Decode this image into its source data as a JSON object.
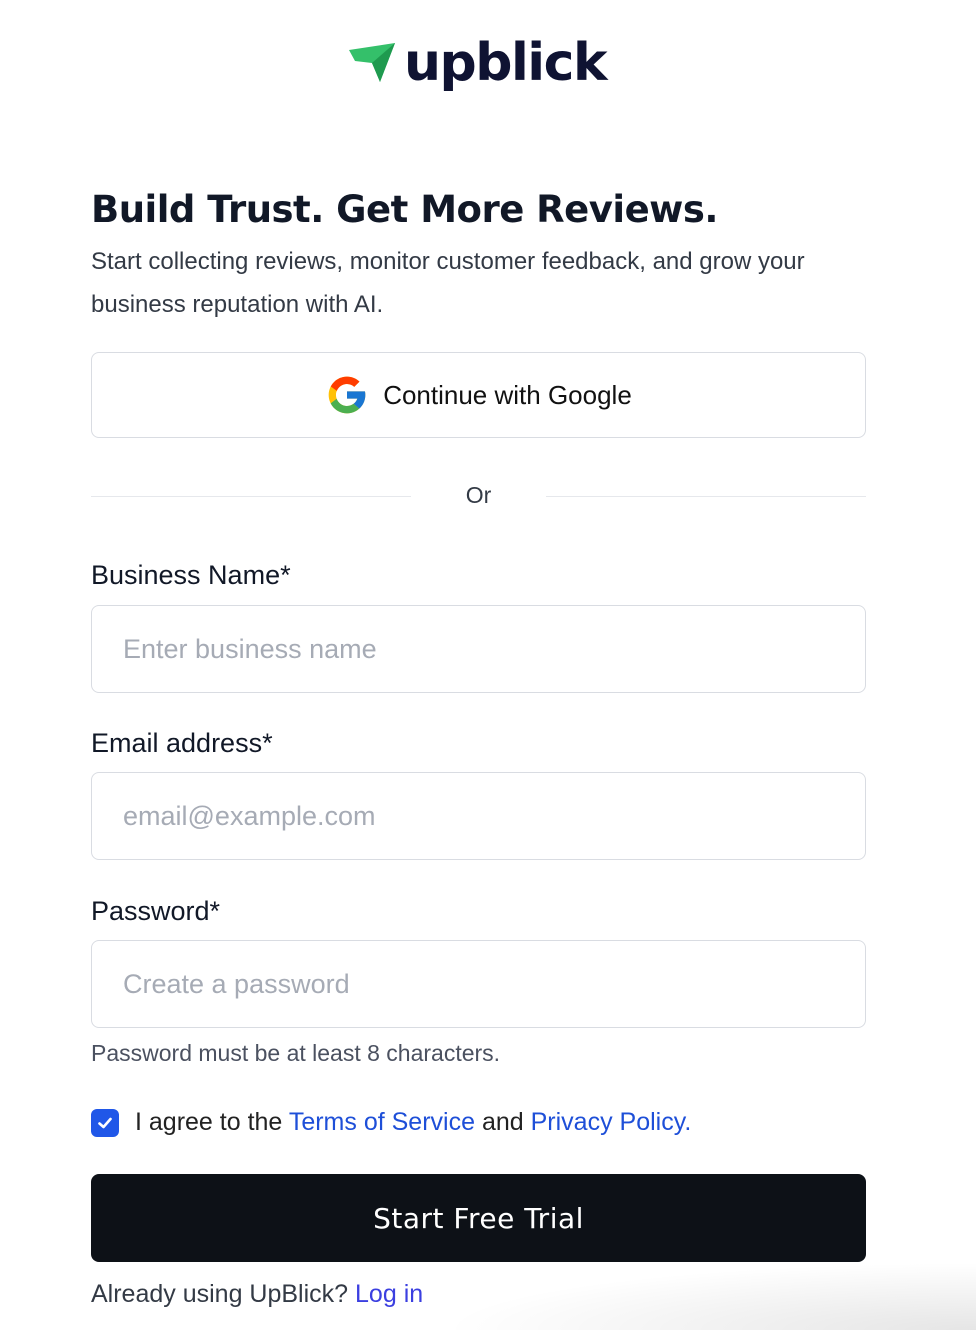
{
  "brand": {
    "name": "upblick",
    "icon": "upblick-logo-icon",
    "color_mark": "#34c06a",
    "color_text": "#0f1332"
  },
  "hero": {
    "title": "Build Trust. Get More Reviews.",
    "subtitle": "Start collecting reviews, monitor customer feedback, and grow your business reputation with AI."
  },
  "google_button": {
    "label": "Continue with Google",
    "icon": "google-icon"
  },
  "divider": {
    "text": "Or"
  },
  "form": {
    "business_name": {
      "label": "Business Name*",
      "placeholder": "Enter business name",
      "value": ""
    },
    "email": {
      "label": "Email address*",
      "placeholder": "email@example.com",
      "value": ""
    },
    "password": {
      "label": "Password*",
      "placeholder": "Create a password",
      "value": "",
      "hint": "Password must be at least 8 characters."
    },
    "agree": {
      "checked": true,
      "prefix": "I agree to the",
      "terms_link": "Terms of Service",
      "middle": "and",
      "privacy_link": "Privacy Policy",
      "suffix": "."
    },
    "submit_label": "Start Free Trial"
  },
  "footer": {
    "prompt": "Already using UpBlick?",
    "login_link": "Log in"
  },
  "colors": {
    "accent_blue": "#2057e8",
    "link_blue": "#1e4fd8",
    "login_link": "#3b3fe0",
    "button_dark": "#0d1117"
  }
}
